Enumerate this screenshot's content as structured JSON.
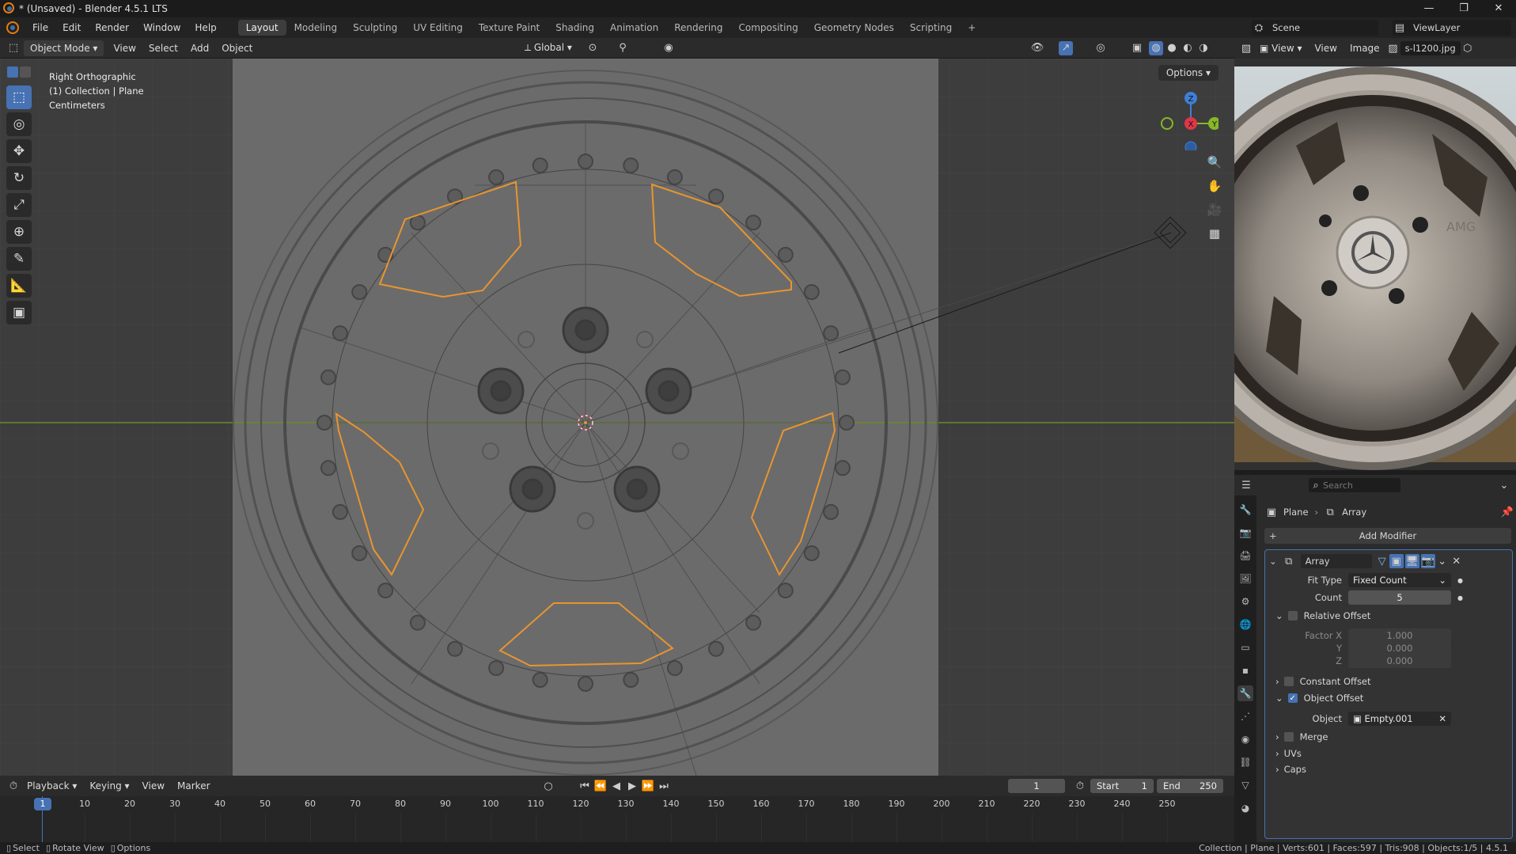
{
  "window": {
    "title": "* (Unsaved) - Blender 4.5.1 LTS",
    "controls": [
      "—",
      "❐",
      "✕"
    ]
  },
  "menubar": {
    "menus": [
      "File",
      "Edit",
      "Render",
      "Window",
      "Help"
    ],
    "workspaces": [
      "Layout",
      "Modeling",
      "Sculpting",
      "UV Editing",
      "Texture Paint",
      "Shading",
      "Animation",
      "Rendering",
      "Compositing",
      "Geometry Nodes",
      "Scripting"
    ],
    "active_workspace": "Layout",
    "add_label": "+",
    "scene": "Scene",
    "view_layer": "ViewLayer"
  },
  "viewport_header": {
    "mode": "Object Mode",
    "menus": [
      "View",
      "Select",
      "Add",
      "Object"
    ],
    "orientation": "Global"
  },
  "viewport": {
    "view_name": "Right Orthographic",
    "collection": "(1) Collection | Plane",
    "units": "Centimeters",
    "options_label": "Options",
    "gizmo": {
      "z": "Z",
      "x": "X",
      "y": "Y"
    }
  },
  "image_editor": {
    "menus": [
      "View",
      "View",
      "Image"
    ],
    "image_name": "s-l1200.jpg",
    "wheel_text": "AMG"
  },
  "properties": {
    "search_placeholder": "Search",
    "breadcrumb": {
      "object": "Plane",
      "sep": "›",
      "modifier": "Array"
    },
    "add_modifier": "Add Modifier",
    "modifier_name": "Array",
    "fit_type_label": "Fit Type",
    "fit_type_value": "Fixed Count",
    "count_label": "Count",
    "count_value": "5",
    "relative_offset": "Relative Offset",
    "factor_x_label": "Factor X",
    "factor_x": "1.000",
    "y_label": "Y",
    "factor_y": "0.000",
    "z_label": "Z",
    "factor_z": "0.000",
    "constant_offset": "Constant Offset",
    "object_offset": "Object Offset",
    "object_label": "Object",
    "object_value": "Empty.001",
    "merge": "Merge",
    "uvs": "UVs",
    "caps": "Caps"
  },
  "timeline": {
    "menus": [
      "Playback",
      "Keying",
      "View",
      "Marker"
    ],
    "current_frame": "1",
    "start_label": "Start",
    "start": "1",
    "end_label": "End",
    "end": "250",
    "ticks": [
      "10",
      "20",
      "30",
      "40",
      "50",
      "60",
      "70",
      "80",
      "90",
      "100",
      "110",
      "120",
      "130",
      "140",
      "150",
      "160",
      "170",
      "180",
      "190",
      "200",
      "210",
      "220",
      "230",
      "240",
      "250"
    ],
    "playhead": "1"
  },
  "statusbar": {
    "select": "Select",
    "rotate": "Rotate View",
    "options": "Options",
    "stats": "Collection | Plane | Verts:601 | Faces:597 | Tris:908 | Objects:1/5 | 4.5.1"
  },
  "colors": {
    "accent": "#4772b3",
    "selection_outline": "#e8952f",
    "x_axis": "#e0364a",
    "y_axis": "#86b828",
    "z_axis": "#3f7fd6"
  }
}
